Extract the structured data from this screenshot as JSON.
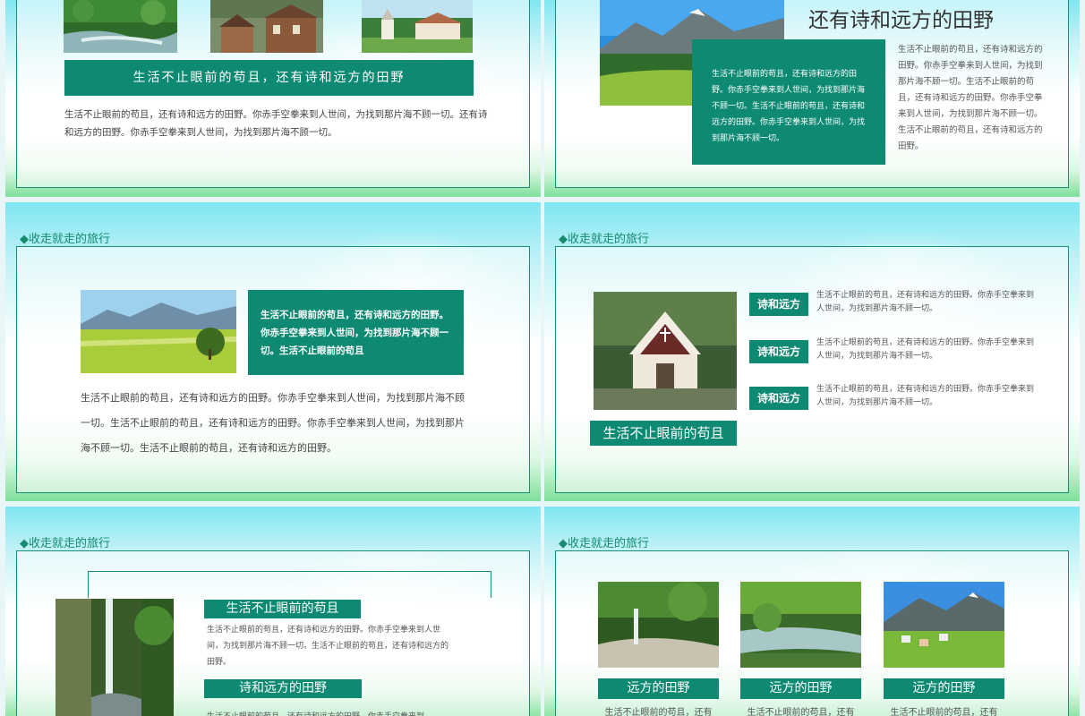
{
  "header_title": "◆收走就走的旅行",
  "slide1": {
    "banner": "生活不止眼前的苟且，还有诗和远方的田野",
    "body": "生活不止眼前的苟且，还有诗和远方的田野。你赤手空拳来到人世间，为找到那片海不顾一切。还有诗和远方的田野。你赤手空拳来到人世间，为找到那片海不顾一切。"
  },
  "slide2": {
    "title": "还有诗和远方的田野",
    "box_text": "生活不止眼前的苟且，还有诗和远方的田野。你赤手空拳来到人世间，为找到那片海不顾一切。生活不止眼前的苟且，还有诗和远方的田野。你赤手空拳来到人世间，为找到那片海不顾一切。",
    "side_text": "生活不止眼前的苟且，还有诗和远方的田野。你赤手空拳来到人世间，为找到那片海不顾一切。生活不止眼前的苟且，还有诗和远方的田野。你赤手空拳来到人世间，为找到那片海不顾一切。生活不止眼前的苟且，还有诗和远方的田野。"
  },
  "slide3": {
    "box_text": "生活不止眼前的苟且，还有诗和远方的田野。你赤手空拳来到人世间，为找到那片海不顾一切。生活不止眼前的苟且",
    "body": "生活不止眼前的苟且，还有诗和远方的田野。你赤手空拳来到人世间，为找到那片海不顾一切。生活不止眼前的苟且，还有诗和远方的田野。你赤手空拳来到人世间，为找到那片海不顾一切。生活不止眼前的苟且，还有诗和远方的田野。"
  },
  "slide4": {
    "caption": "生活不止眼前的苟且",
    "items": [
      {
        "label": "诗和远方",
        "text": "生活不止眼前的苟且，还有诗和远方的田野。你赤手空拳来到人世间，为找到那片海不顾一切。"
      },
      {
        "label": "诗和远方",
        "text": "生活不止眼前的苟且，还有诗和远方的田野。你赤手空拳来到人世间，为找到那片海不顾一切。"
      },
      {
        "label": "诗和远方",
        "text": "生活不止眼前的苟且，还有诗和远方的田野。你赤手空拳来到人世间，为找到那片海不顾一切。"
      }
    ]
  },
  "slide5": {
    "label1": "生活不止眼前的苟且",
    "text1": "生活不止眼前的苟且，还有诗和远方的田野。你赤手空拳来到人世间，为找到那片海不顾一切。生活不止眼前的苟且，还有诗和远方的田野。",
    "label2": "诗和远方的田野",
    "text2": "生活不止眼前的苟且，还有诗和远方的田野。你赤手空拳来到"
  },
  "slide6": {
    "labels": [
      "远方的田野",
      "远方的田野",
      "远方的田野"
    ],
    "texts": [
      "生活不止眼前的苟且，还有",
      "生活不止眼前的苟且，还有",
      "生活不止眼前的苟且，还有"
    ]
  },
  "colors": {
    "accent": "#0e8a73",
    "frame": "#1a8f74",
    "sky": "#7fe7f2",
    "grass": "#7fe09a"
  }
}
